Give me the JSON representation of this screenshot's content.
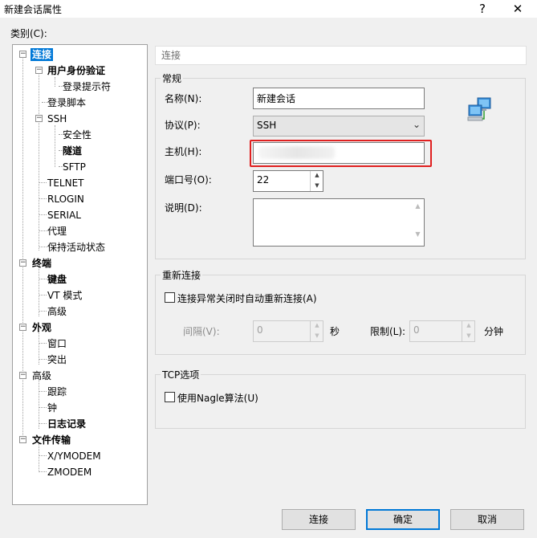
{
  "window": {
    "title": "新建会话属性",
    "help_glyph": "?",
    "close_glyph": "✕"
  },
  "category_label": "类别(C):",
  "tree": [
    {
      "label": "连接",
      "bold": true,
      "selected": true
    },
    {
      "label": "用户身份验证",
      "bold": true
    },
    {
      "label": "登录提示符"
    },
    {
      "label": "登录脚本"
    },
    {
      "label": "SSH"
    },
    {
      "label": "安全性"
    },
    {
      "label": "隧道",
      "bold": true
    },
    {
      "label": "SFTP"
    },
    {
      "label": "TELNET"
    },
    {
      "label": "RLOGIN"
    },
    {
      "label": "SERIAL"
    },
    {
      "label": "代理"
    },
    {
      "label": "保持活动状态"
    },
    {
      "label": "终端",
      "bold": true
    },
    {
      "label": "键盘",
      "bold": true
    },
    {
      "label": "VT 模式"
    },
    {
      "label": "高级"
    },
    {
      "label": "外观",
      "bold": true
    },
    {
      "label": "窗口"
    },
    {
      "label": "突出"
    },
    {
      "label": "高级"
    },
    {
      "label": "跟踪"
    },
    {
      "label": "钟"
    },
    {
      "label": "日志记录",
      "bold": true
    },
    {
      "label": "文件传输",
      "bold": true
    },
    {
      "label": "X/YMODEM"
    },
    {
      "label": "ZMODEM"
    }
  ],
  "panel_header": "连接",
  "general": {
    "title": "常规",
    "name_label": "名称(N):",
    "name_value": "新建会话",
    "protocol_label": "协议(P):",
    "protocol_value": "SSH",
    "host_label": "主机(H):",
    "host_value": "",
    "port_label": "端口号(O):",
    "port_value": "22",
    "desc_label": "说明(D):",
    "desc_value": "",
    "icon": "network-computers-icon"
  },
  "reconnect": {
    "title": "重新连接",
    "checkbox_label": "连接异常关闭时自动重新连接(A)",
    "checked": false,
    "interval_label": "间隔(V):",
    "interval_value": "0",
    "interval_unit": "秒",
    "limit_label": "限制(L):",
    "limit_value": "0",
    "limit_unit": "分钟"
  },
  "tcp": {
    "title": "TCP选项",
    "nagle_label": "使用Nagle算法(U)",
    "checked": false
  },
  "buttons": {
    "connect": "连接",
    "ok": "确定",
    "cancel": "取消"
  },
  "colors": {
    "selection": "#0078d7",
    "highlight_box": "#e02020"
  }
}
